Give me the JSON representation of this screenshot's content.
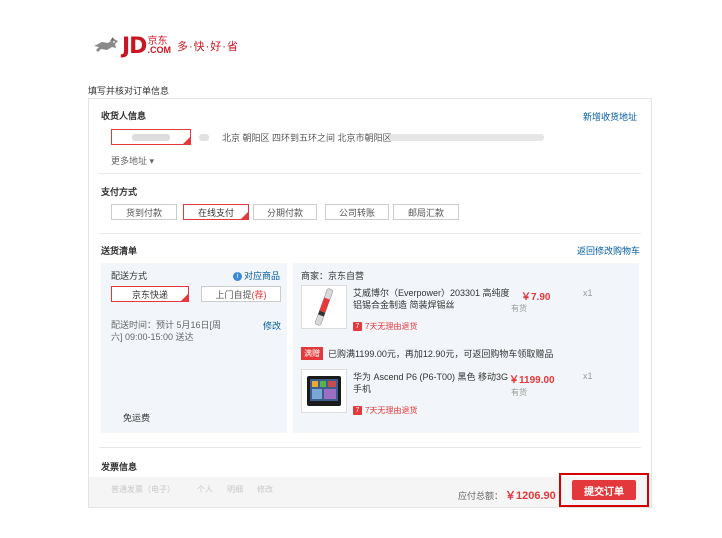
{
  "header": {
    "logo_text": "JD",
    "logo_com": ".COM",
    "logo_cn": "京东",
    "slogan": "多·快·好·省",
    "brand_color": "#c81623"
  },
  "page_title": "填写并核对订单信息",
  "address": {
    "title": "收货人信息",
    "add_link": "新增收货地址",
    "detail": "北京 朝阳区 四环到五环之间 北京市朝阳区",
    "more": "更多地址 ▾"
  },
  "payment": {
    "title": "支付方式",
    "options": [
      "货到付款",
      "在线支付",
      "分期付款",
      "公司转账",
      "邮局汇款"
    ],
    "selected": "在线支付"
  },
  "shipping": {
    "title": "送货清单",
    "back_link": "返回修改购物车",
    "method_label": "配送方式",
    "goods_link": "对应商品",
    "info_icon": "info-icon",
    "methods": [
      "京东快递",
      "上门自提"
    ],
    "pickup_suffix": "(荐)",
    "time_label": "配送时间：",
    "time_value": "预计 5月16日[周六] 09:00-15:00 送达",
    "modify": "修改",
    "free_shipping": "免运费",
    "merchant": "商家：京东自营",
    "products": [
      {
        "name": "艾威博尔（Everpower）203301 高纯度铝锡合金制造 简装焊锡丝",
        "price": "￥7.90",
        "stock": "有货",
        "qty": "x1",
        "return_policy": "7天无理由退货"
      },
      {
        "name": "华为 Ascend P6 (P6-T00) 黑色 移动3G手机",
        "price": "￥1199.00",
        "stock": "有货",
        "qty": "x1",
        "return_policy": "7天无理由退货"
      }
    ],
    "promo_tag": "满赠",
    "promo_text": "已购满1199.00元，再加12.90元，可返回购物车领取赠品"
  },
  "invoice": {
    "title": "发票信息",
    "blurred": [
      "普通发票（电子）",
      "个人",
      "明细",
      "修改"
    ]
  },
  "summary": {
    "total_label": "应付总额：",
    "total_value": "￥1206.90",
    "submit": "提交订单"
  }
}
